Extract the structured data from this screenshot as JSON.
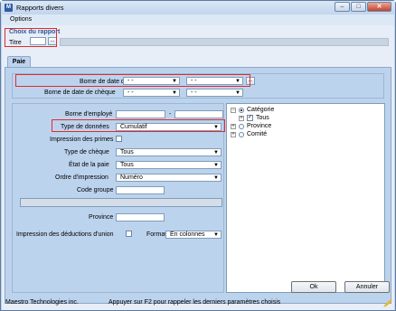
{
  "window": {
    "title": "Rapports divers",
    "app_icon": "M"
  },
  "menu": {
    "options": "Options"
  },
  "report_group": {
    "title": "Choix du rapport",
    "titre_label": "Titre",
    "ellipsis": "..."
  },
  "tabs": [
    {
      "label": "Paie"
    }
  ],
  "dates": {
    "borne_paie_label": "Borne de date de paie",
    "borne_cheque_label": "Borne de date de chèque",
    "empty_date": "- -",
    "ellipsis": "..."
  },
  "filters": {
    "borne_employe_label": "Borne d'employé",
    "range_dash": "-",
    "type_donnees_label": "Type de données",
    "type_donnees_value": "Cumulatif",
    "impression_primes_label": "Impression des primes",
    "type_cheque_label": "Type de chèque",
    "type_cheque_value": "Tous",
    "etat_paie_label": "État de la paie",
    "etat_paie_value": "Tous",
    "ordre_impression_label": "Ordre d'impression",
    "ordre_impression_value": "Numéro",
    "code_groupe_label": "Code groupe",
    "province_label": "Province",
    "deductions_union_label": "Impression des déductions d'union",
    "format_label": "Format",
    "format_value": "En colonnes"
  },
  "tree": {
    "root": "Catégorie",
    "child": "Tous",
    "province": "Province",
    "comite": "Comité",
    "expand_minus": "−",
    "expand_plus": "+"
  },
  "footer": {
    "company": "Maestro Technologies inc.",
    "hint": "Appuyer sur F2 pour rappeler les derniers paramètres choisis",
    "ok": "Ok",
    "cancel": "Annuler"
  }
}
